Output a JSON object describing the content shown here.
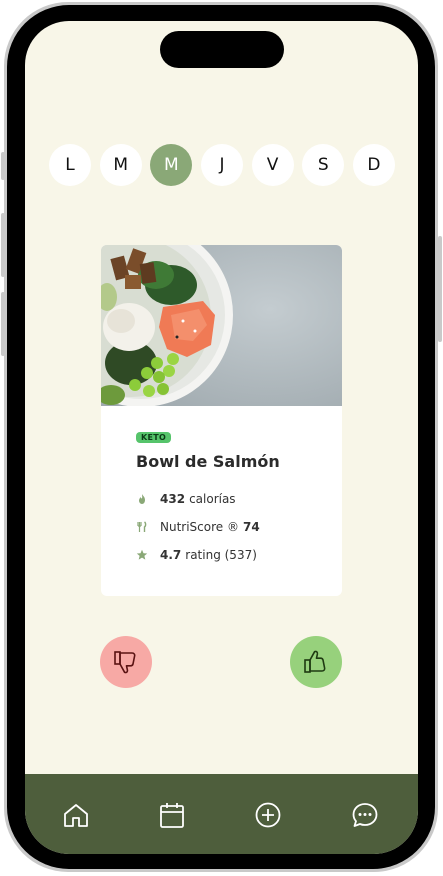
{
  "week_days": [
    {
      "label": "L",
      "selected": false
    },
    {
      "label": "M",
      "selected": false
    },
    {
      "label": "M",
      "selected": true
    },
    {
      "label": "J",
      "selected": false
    },
    {
      "label": "V",
      "selected": false
    },
    {
      "label": "S",
      "selected": false
    },
    {
      "label": "D",
      "selected": false
    }
  ],
  "meal_card": {
    "tag": "KETO",
    "title": "Bowl de Salmón",
    "calories": {
      "value": "432",
      "unit": "calorías"
    },
    "nutriscore": {
      "prefix": "NutriScore ®",
      "value": "74"
    },
    "rating": {
      "value": "4.7",
      "suffix": "rating (537)"
    },
    "image_icon": "salmon-bowl-photo"
  },
  "actions": {
    "dislike_icon": "thumbs-down-icon",
    "like_icon": "thumbs-up-icon"
  },
  "tab_bar": {
    "items": [
      "home-icon",
      "calendar-icon",
      "add-icon",
      "chat-icon"
    ]
  },
  "colors": {
    "background": "#f8f6e8",
    "accent": "#8aa877",
    "tab_bar": "#4e5e3c",
    "keto_tag": "#56c46b",
    "dislike": "#f7a9a5",
    "like": "#97d17c"
  }
}
